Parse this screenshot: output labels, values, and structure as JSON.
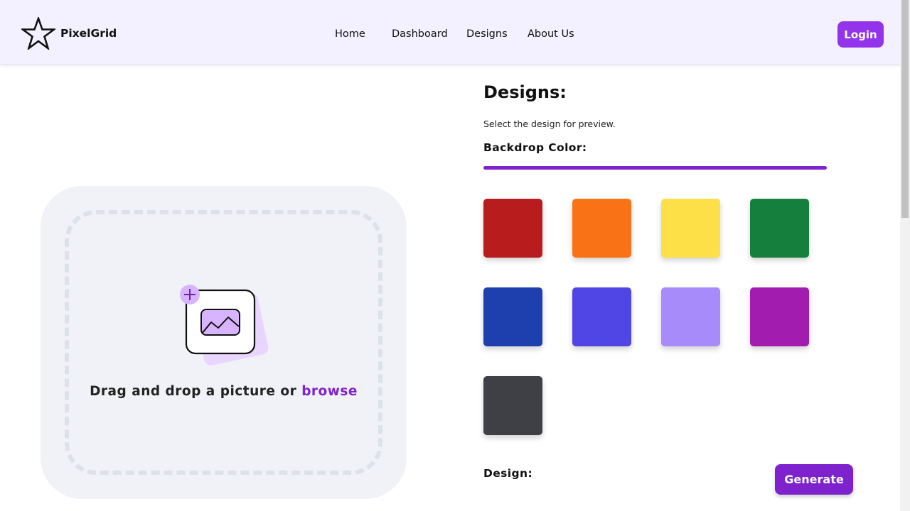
{
  "header": {
    "brand": "PixelGrid",
    "nav": [
      "Home",
      "Dashboard",
      "Designs",
      "About Us"
    ],
    "login_label": "Login"
  },
  "upload": {
    "prompt": "Drag and drop a picture or ",
    "browse_label": "browse"
  },
  "designs": {
    "title": "Designs:",
    "subtitle": "Select the design for preview.",
    "backdrop_label": "Backdrop Color:",
    "swatches": [
      {
        "name": "red",
        "color": "#b91c1c"
      },
      {
        "name": "orange",
        "color": "#f97316"
      },
      {
        "name": "yellow",
        "color": "#fde047"
      },
      {
        "name": "green",
        "color": "#15803d"
      },
      {
        "name": "blue",
        "color": "#1e40af"
      },
      {
        "name": "indigo",
        "color": "#4f46e5"
      },
      {
        "name": "lavender",
        "color": "#a78bfa"
      },
      {
        "name": "purple",
        "color": "#a21caf"
      },
      {
        "name": "charcoal",
        "color": "#3f3f46"
      }
    ],
    "design_label": "Design:",
    "generate_label": "Generate"
  },
  "colors": {
    "accent": "#7e22ce",
    "login_bg": "#9333ea",
    "header_bg": "#f3f0ff",
    "upload_bg": "#f0f2f7"
  },
  "icons": {
    "logo": "star-icon",
    "upload": "add-image-icon"
  }
}
